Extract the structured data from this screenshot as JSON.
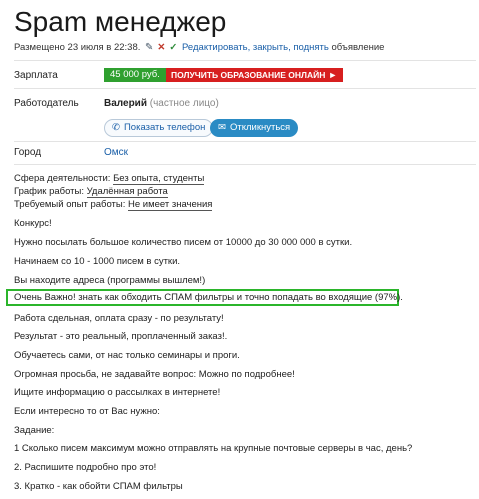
{
  "title": "Spam менеджер",
  "meta": {
    "posted": "Размещено 23 июля в 22:38.",
    "edit_links": "Редактировать, закрыть, поднять",
    "suffix": "объявление"
  },
  "salary": {
    "label": "Зарплата",
    "value": "45 000 руб.",
    "promo": "ПОЛУЧИТЬ ОБРАЗОВАНИЕ ОНЛАЙН",
    "promo_arrow": "►"
  },
  "employer": {
    "label": "Работодатель",
    "name": "Валерий",
    "type": "(частное лицо)",
    "phone_button": "Показать телефон",
    "respond_button": "Откликнуться"
  },
  "city": {
    "label": "Город",
    "value": "Омск"
  },
  "specs": [
    {
      "label": "Сфера деятельности:",
      "value": "Без опыта, студенты"
    },
    {
      "label": "График работы:",
      "value": "Удалённая работа"
    },
    {
      "label": "Требуемый опыт работы:",
      "value": "Не имеет значения"
    }
  ],
  "description": [
    "Конкурс!",
    "Нужно посылать большое количество писем от 10000 до 30 000 000 в сутки.",
    "Начинаем со 10 - 1000 писем в сутки.",
    "Вы находите адреса (программы вышлем!)",
    "Очень Важно! знать как обходить СПАМ фильтры и точно попадать во входящие (97%).",
    "Работа сдельная, оплата сразу - по результату!",
    "Результат - это реальный, проплаченный заказ!.",
    "Обучаетесь сами, от нас только семинары и проги.",
    "Огромная просьба, не задавайте вопрос: Можно по подробнее!",
    "Ищите информацию о рассылках в интернете!",
    "Если интересно то от Вас нужно:",
    "Задание:",
    "1 Сколько писем максимум можно отправлять на крупные почтовые серверы в час, день?",
    "2. Распишите подробно про это!",
    "3. Кратко - как обойти СПАМ фильтры"
  ],
  "colors": {
    "salary_bg": "#2fa02f",
    "promo_bg": "#d71f1f",
    "link": "#1a5fa8",
    "highlight_border": "#2bb52b"
  }
}
